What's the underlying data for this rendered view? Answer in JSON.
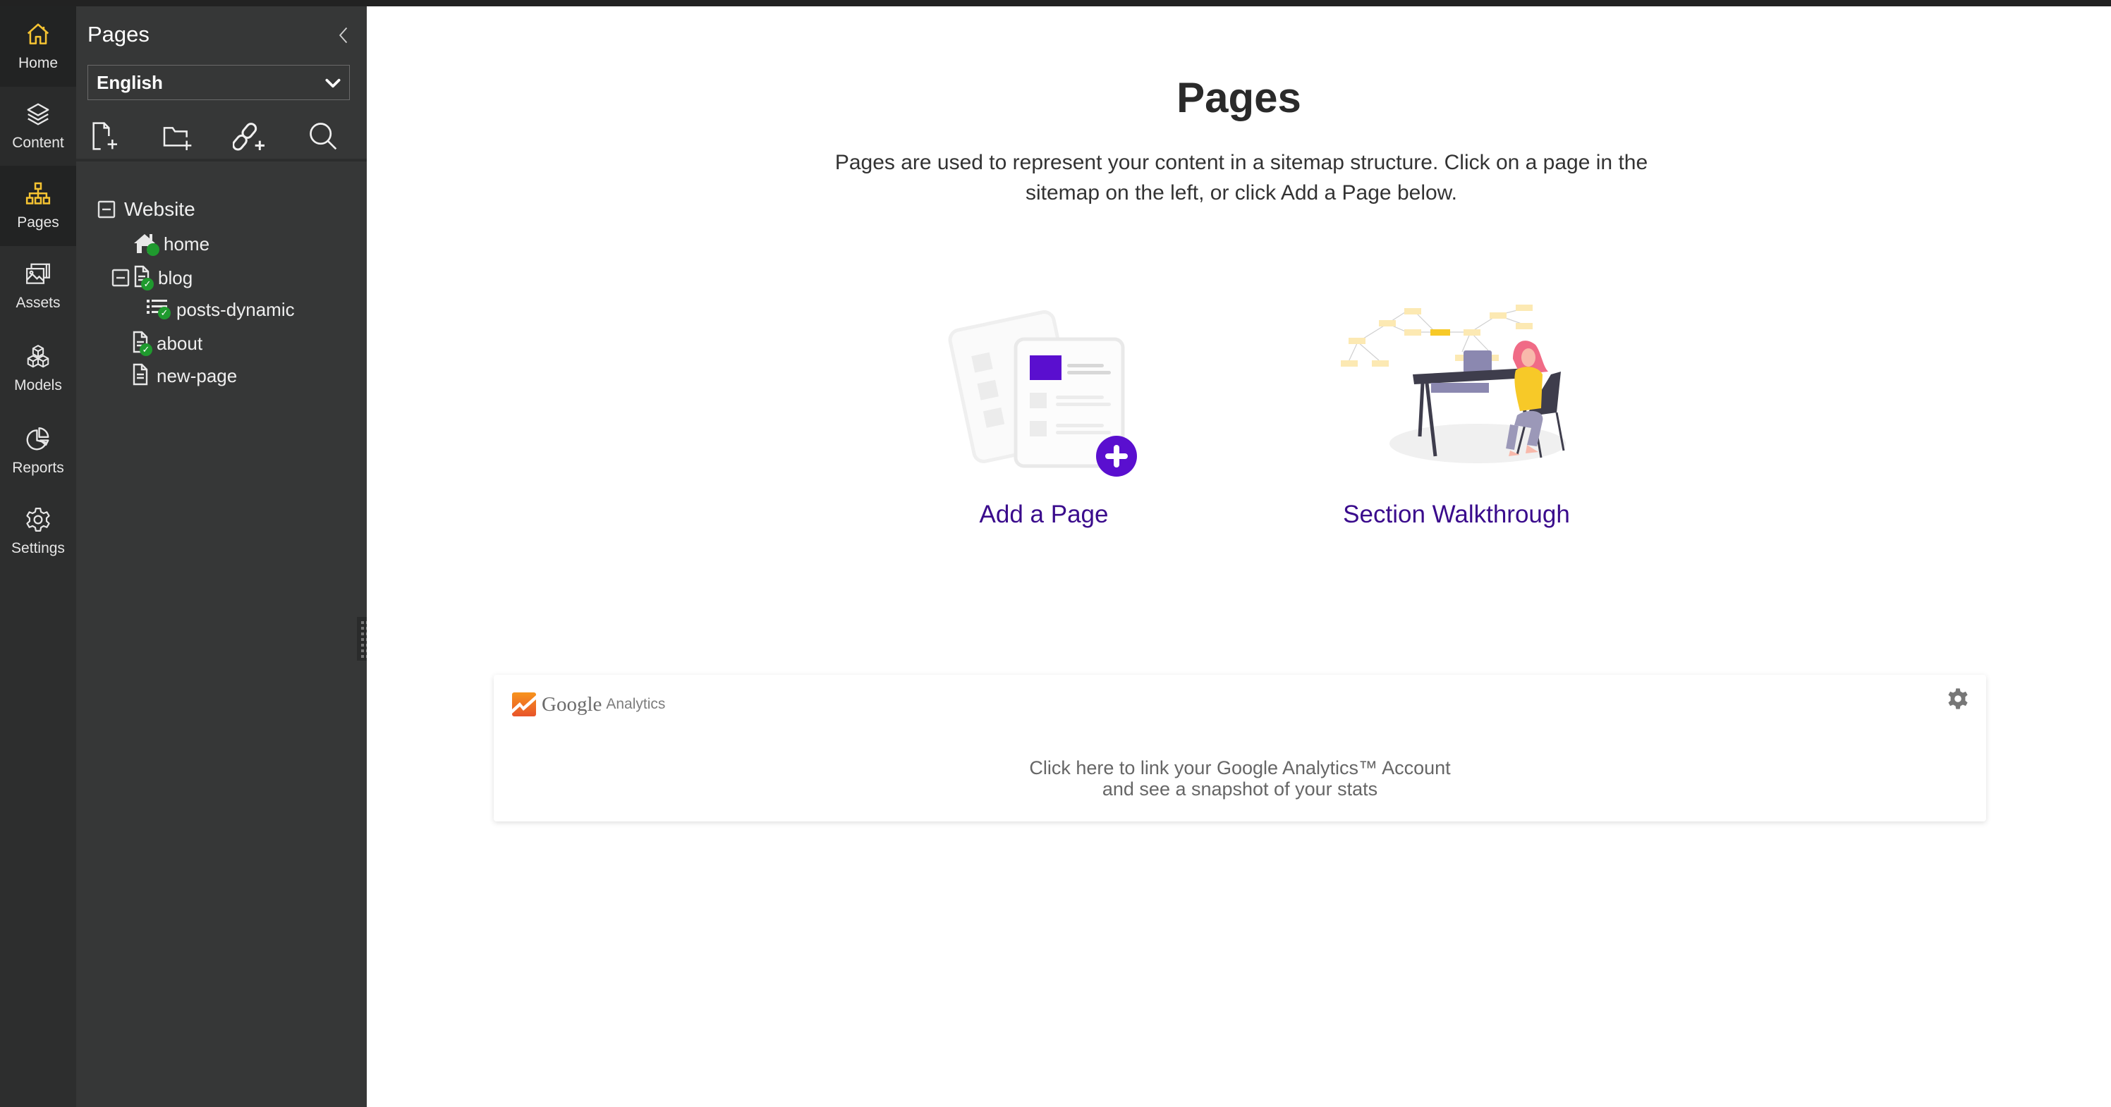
{
  "rail": {
    "items": [
      {
        "label": "Home",
        "icon": "home-icon",
        "active": true
      },
      {
        "label": "Content",
        "icon": "layers-icon",
        "active": false
      },
      {
        "label": "Pages",
        "icon": "sitemap-icon",
        "active": true
      },
      {
        "label": "Assets",
        "icon": "images-icon",
        "active": false
      },
      {
        "label": "Models",
        "icon": "cubes-icon",
        "active": false
      },
      {
        "label": "Reports",
        "icon": "pie-chart-icon",
        "active": false
      },
      {
        "label": "Settings",
        "icon": "gear-icon",
        "active": false
      }
    ]
  },
  "panel": {
    "title": "Pages",
    "language": {
      "selected": "English"
    },
    "tools": [
      "add-page-icon",
      "add-folder-icon",
      "add-link-icon",
      "search-icon"
    ],
    "tree": {
      "root": "Website",
      "nodes": [
        {
          "label": "home",
          "type": "homepage",
          "status": "published"
        },
        {
          "label": "blog",
          "type": "page",
          "status": "published",
          "expanded": true
        },
        {
          "label": "posts-dynamic",
          "type": "dynamic-list",
          "status": "published"
        },
        {
          "label": "about",
          "type": "page",
          "status": "published"
        },
        {
          "label": "new-page",
          "type": "page",
          "status": "draft"
        }
      ]
    }
  },
  "main": {
    "title": "Pages",
    "description": "Pages are used to represent your content in a sitemap structure. Click on a page in the sitemap on the left, or click Add a Page below.",
    "cards": [
      {
        "label": "Add a Page",
        "icon": "add-page-illustration"
      },
      {
        "label": "Section Walkthrough",
        "icon": "walkthrough-illustration"
      }
    ],
    "analytics": {
      "brand_google": "Google",
      "brand_analytics": "Analytics",
      "message_line1": "Click here to link your Google Analytics™ Account",
      "message_line2": "and see a snapshot of your stats"
    }
  },
  "colors": {
    "accent": "#f5c332",
    "link": "#3a0b8c",
    "brand_purple": "#5a0fcf",
    "status_green": "#1f9a2e"
  }
}
